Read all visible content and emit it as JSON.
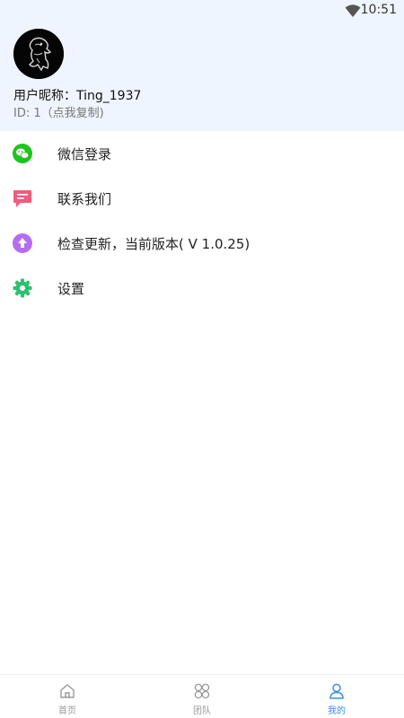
{
  "status_bar": {
    "time": "10:51",
    "icons": [
      "wifi-icon"
    ]
  },
  "profile": {
    "avatar_icon": "lion-crest-avatar",
    "nickname": "用户昵称：Ting_1937",
    "id_text": "ID: 1（点我复制)"
  },
  "menu": {
    "items": [
      {
        "label": "微信登录",
        "icon": "wechat-icon",
        "color": "#1fc41f"
      },
      {
        "label": "联系我们",
        "icon": "message-icon",
        "color": "#ef5c7e"
      },
      {
        "label": "检查更新，当前版本( V 1.0.25)",
        "icon": "upload-arrow-icon",
        "color": "#b66cf0"
      },
      {
        "label": "设置",
        "icon": "settings-gear-icon",
        "color": "#2fbf71"
      }
    ]
  },
  "tabbar": {
    "tabs": [
      {
        "label": "首页",
        "icon": "home-icon",
        "active": false
      },
      {
        "label": "团队",
        "icon": "grid-circles-icon",
        "active": false
      },
      {
        "label": "我的",
        "icon": "person-icon",
        "active": true
      }
    ],
    "active_color": "#3b8ee0",
    "inactive_color": "#999999"
  }
}
